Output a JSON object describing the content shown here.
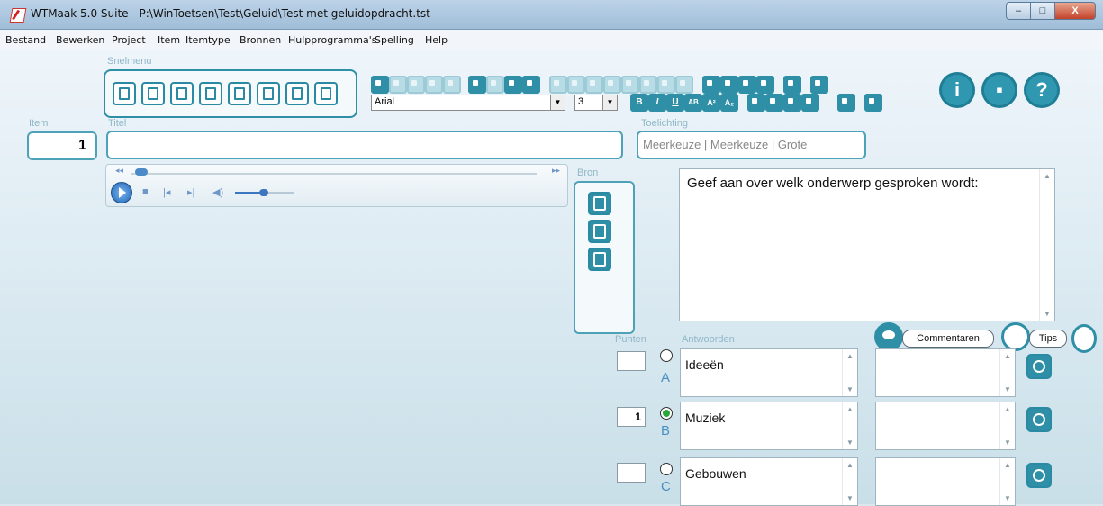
{
  "window": {
    "title": "WTMaak 5.0 Suite - P:\\WinToetsen\\Test\\Geluid\\Test met geluidopdracht.tst -",
    "min": "–",
    "max": "□",
    "close": "X"
  },
  "menu": [
    "Bestand",
    "Bewerken",
    "Project",
    "Item",
    "Itemtype",
    "Bronnen",
    "Hulpprogramma's",
    "Spelling",
    "Help"
  ],
  "labels": {
    "snelmenu": "Snelmenu",
    "item": "Item",
    "titel": "Titel",
    "toelichting": "Toelichting",
    "bron": "Bron",
    "punten": "Punten",
    "antwoorden": "Antwoorden"
  },
  "toolbar": {
    "font": "Arial",
    "size": "3",
    "bold": "B",
    "italic": "I",
    "underline": "U",
    "strike": "AB",
    "superscript": "A²",
    "subscript": "A₂"
  },
  "item": {
    "number": "1"
  },
  "titel": {
    "value": ""
  },
  "toelichting": {
    "value": "Meerkeuze | Meerkeuze | Grote"
  },
  "question": {
    "text": "Geef aan over welk onderwerp gesproken wordt:"
  },
  "buttons": {
    "commentaren": "Commentaren",
    "tips": "Tips"
  },
  "answers": [
    {
      "letter": "A",
      "text": "Ideeën",
      "points": "",
      "selected": false
    },
    {
      "letter": "B",
      "text": "Muziek",
      "points": "1",
      "selected": true
    },
    {
      "letter": "C",
      "text": "Gebouwen",
      "points": "",
      "selected": false
    }
  ],
  "icons": {
    "snelmenu": [
      "new-file-icon",
      "open-file-icon",
      "save-icon",
      "info-icon",
      "spellcheck-icon",
      "edit-icon",
      "export-icon",
      "globe-icon"
    ],
    "bron": [
      "new-source-icon",
      "image-source-icon",
      "frame-source-icon"
    ]
  },
  "colors": {
    "accent": "#2e8fa6",
    "correct": "#29a83a"
  }
}
